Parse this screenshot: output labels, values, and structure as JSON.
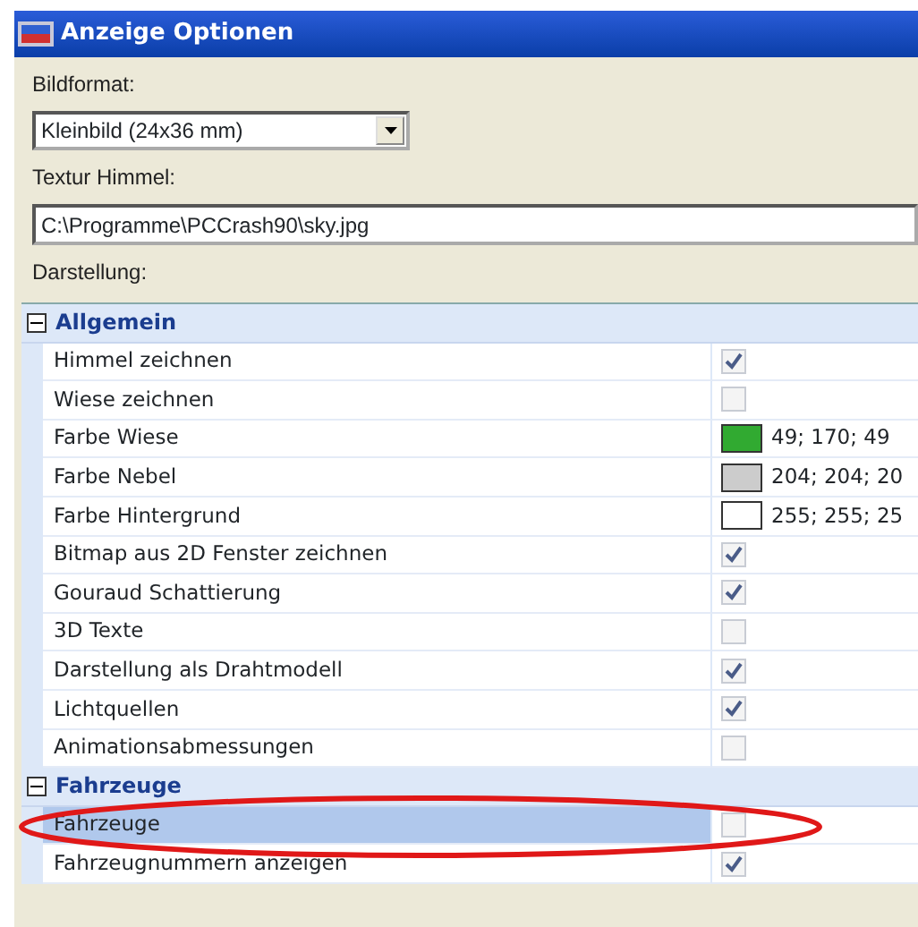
{
  "window": {
    "title": "Anzeige Optionen"
  },
  "bildformat": {
    "label": "Bildformat:",
    "value": "Kleinbild (24x36 mm)"
  },
  "textur": {
    "label": "Textur Himmel:",
    "value": "C:\\Programme\\PCCrash90\\sky.jpg"
  },
  "darstellung": {
    "label": "Darstellung:",
    "groups": [
      {
        "title": "Allgemein",
        "expanded": true,
        "rows": [
          {
            "name": "Himmel zeichnen",
            "kind": "checkbox",
            "checked": true,
            "selected": false
          },
          {
            "name": "Wiese zeichnen",
            "kind": "checkbox",
            "checked": false,
            "selected": false
          },
          {
            "name": "Farbe Wiese",
            "kind": "color",
            "color": "#31aa31",
            "value": "49; 170; 49",
            "selected": false
          },
          {
            "name": "Farbe Nebel",
            "kind": "color",
            "color": "#cccccc",
            "value": "204; 204; 20",
            "selected": false
          },
          {
            "name": "Farbe Hintergrund",
            "kind": "color",
            "color": "#ffffff",
            "value": "255; 255; 25",
            "selected": false
          },
          {
            "name": "Bitmap aus 2D Fenster zeichnen",
            "kind": "checkbox",
            "checked": true,
            "selected": false
          },
          {
            "name": "Gouraud Schattierung",
            "kind": "checkbox",
            "checked": true,
            "selected": false
          },
          {
            "name": "3D Texte",
            "kind": "checkbox",
            "checked": false,
            "selected": false
          },
          {
            "name": "Darstellung als Drahtmodell",
            "kind": "checkbox",
            "checked": true,
            "selected": false
          },
          {
            "name": "Lichtquellen",
            "kind": "checkbox",
            "checked": true,
            "selected": false
          },
          {
            "name": "Animationsabmessungen",
            "kind": "checkbox",
            "checked": false,
            "selected": false
          }
        ]
      },
      {
        "title": "Fahrzeuge",
        "expanded": true,
        "rows": [
          {
            "name": "Fahrzeuge",
            "kind": "checkbox",
            "checked": false,
            "selected": true,
            "annotated": true
          },
          {
            "name": "Fahrzeugnummern anzeigen",
            "kind": "checkbox",
            "checked": true,
            "selected": false
          }
        ]
      }
    ]
  }
}
